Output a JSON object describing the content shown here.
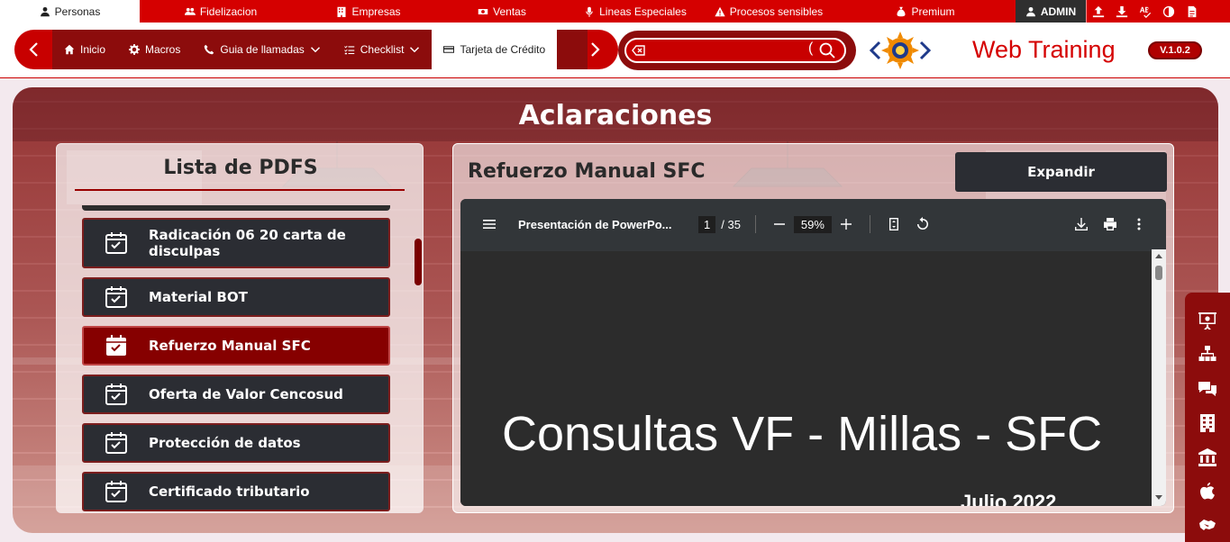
{
  "top_nav": {
    "tabs": [
      {
        "label": "Personas",
        "icon": "person-icon"
      },
      {
        "label": "Fidelizacion",
        "icon": "users-icon"
      },
      {
        "label": "Empresas",
        "icon": "building-icon"
      },
      {
        "label": "Ventas",
        "icon": "money-icon"
      },
      {
        "label": "Lineas Especiales",
        "icon": "microphone-icon"
      },
      {
        "label": "Procesos sensibles",
        "icon": "warning-icon"
      },
      {
        "label": "Premium",
        "icon": "money-bag-icon"
      }
    ],
    "admin_label": "ADMIN",
    "tool_icons": [
      "upload-icon",
      "download-icon",
      "spellcheck-icon",
      "contrast-icon",
      "document-icon"
    ]
  },
  "nav": {
    "items": [
      {
        "label": "Inicio",
        "icon": "home-icon"
      },
      {
        "label": "Macros",
        "icon": "gear-icon"
      },
      {
        "label": "Guia de llamadas",
        "icon": "phone-icon"
      },
      {
        "label": "Checklist",
        "icon": "checklist-icon"
      },
      {
        "label": "Tarjeta de Crédito",
        "icon": "credit-card-icon"
      }
    ]
  },
  "search": {
    "placeholder": ""
  },
  "brand": {
    "name": "Web Training",
    "version": "V.1.0.2"
  },
  "section": {
    "title": "Aclaraciones"
  },
  "pdf_list": {
    "title": "Lista de PDFS",
    "items": [
      {
        "label": "Radicación 06 20 carta de disculpas",
        "active": false
      },
      {
        "label": "Material BOT",
        "active": false
      },
      {
        "label": "Refuerzo Manual SFC",
        "active": true
      },
      {
        "label": "Oferta de Valor Cencosud",
        "active": false
      },
      {
        "label": "Protección de datos",
        "active": false
      },
      {
        "label": "Certificado tributario",
        "active": false
      }
    ]
  },
  "viewer": {
    "title": "Refuerzo Manual SFC",
    "expand_label": "Expandir",
    "doc_name": "Presentación de PowerPo...",
    "page": "1",
    "page_total": "/ 35",
    "zoom": "59%",
    "slide_heading": "Consultas VF - Millas - SFC",
    "slide_date": "Julio 2022"
  },
  "side_rail": [
    "presentation-icon",
    "sitemap-icon",
    "chat-icon",
    "building-icon",
    "bank-icon",
    "apple-icon",
    "handshake-icon"
  ],
  "colors": {
    "brand_red": "#d50000",
    "dark_red": "#8c0c0c",
    "active_item": "#860000",
    "dark_button": "#2b2d33"
  }
}
